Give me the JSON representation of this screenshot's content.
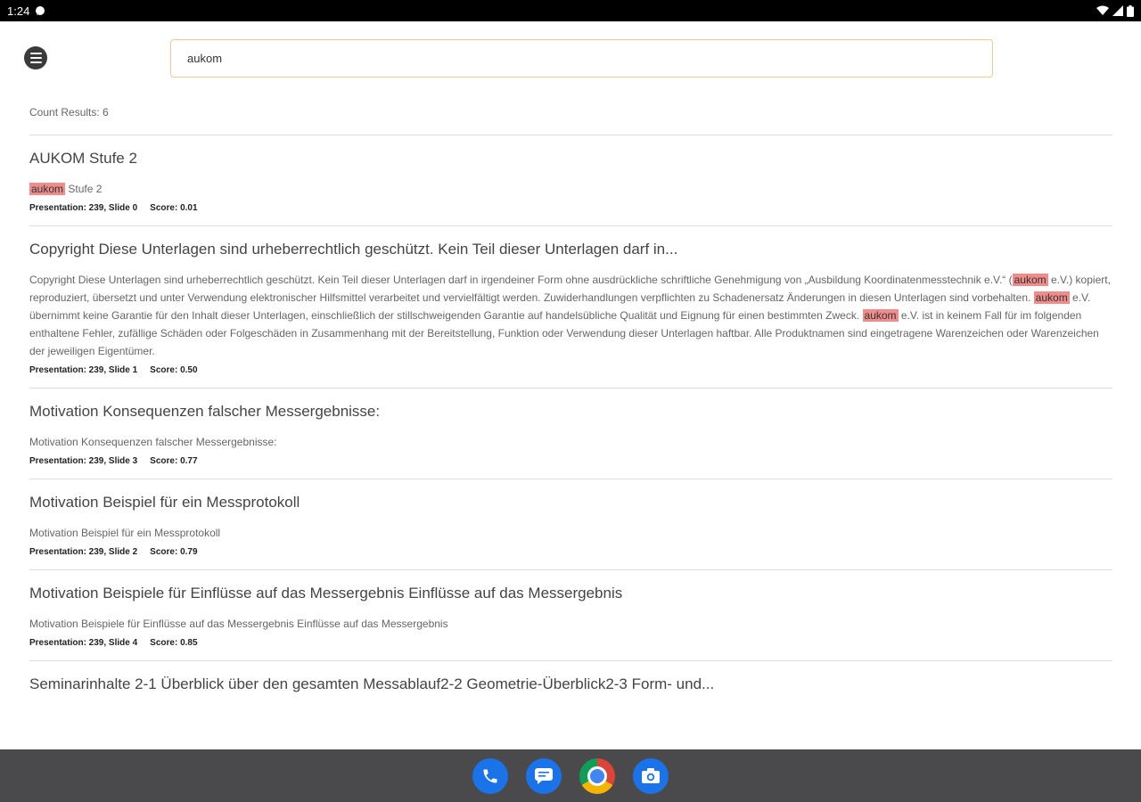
{
  "status_bar": {
    "time": "1:24"
  },
  "search": {
    "value": "aukom"
  },
  "count_label": "Count Results: 6",
  "highlight_term": "aukom",
  "results": [
    {
      "title": "AUKOM Stufe 2",
      "snippet_parts": [
        {
          "hl": true,
          "t": "aukom"
        },
        {
          "hl": false,
          "t": " Stufe 2"
        }
      ],
      "presentation": "Presentation: 239, Slide 0",
      "score": "Score: 0.01"
    },
    {
      "title": "Copyright Diese Unterlagen sind urheberrechtlich geschützt. Kein Teil dieser Unterlagen darf in...",
      "snippet_parts": [
        {
          "hl": false,
          "t": "Copyright Diese Unterlagen sind urheberrechtlich geschützt. Kein Teil dieser Unterlagen darf in irgendeiner Form ohne ausdrückliche schriftliche Genehmigung von „Ausbildung Koordinatenmesstechnik e.V.“ ("
        },
        {
          "hl": true,
          "t": "aukom"
        },
        {
          "hl": false,
          "t": " e.V.) kopiert, reproduziert, übersetzt und unter Verwendung elektronischer Hilfsmittel verarbeitet und vervielfältigt werden. Zuwiderhandlungen verpflichten zu Schadenersatz Änderungen in diesen Unterlagen sind vorbehalten. "
        },
        {
          "hl": true,
          "t": "aukom"
        },
        {
          "hl": false,
          "t": " e.V. übernimmt keine Garantie für den Inhalt dieser Unterlagen, einschließlich der stillschweigenden Garantie auf handelsübliche Qualität und Eignung für einen bestimmten Zweck. "
        },
        {
          "hl": true,
          "t": "aukom"
        },
        {
          "hl": false,
          "t": " e.V. ist in keinem Fall für im folgenden enthaltene Fehler, zufällige Schäden oder Folgeschäden in Zusammenhang mit der Bereitstellung, Funktion oder Verwendung dieser Unterlagen haftbar. Alle Produktnamen sind eingetragene Warenzeichen oder Warenzeichen der jeweiligen Eigentümer."
        }
      ],
      "presentation": "Presentation: 239, Slide 1",
      "score": "Score: 0.50"
    },
    {
      "title": "Motivation Konsequenzen falscher Messergebnisse:",
      "snippet_parts": [
        {
          "hl": false,
          "t": "Motivation Konsequenzen falscher Messergebnisse:"
        }
      ],
      "presentation": "Presentation: 239, Slide 3",
      "score": "Score: 0.77"
    },
    {
      "title": "Motivation Beispiel für ein Messprotokoll",
      "snippet_parts": [
        {
          "hl": false,
          "t": "Motivation Beispiel für ein Messprotokoll"
        }
      ],
      "presentation": "Presentation: 239, Slide 2",
      "score": "Score: 0.79"
    },
    {
      "title": "Motivation Beispiele für Einflüsse auf das Messergebnis Einflüsse auf das Messergebnis",
      "snippet_parts": [
        {
          "hl": false,
          "t": "Motivation Beispiele für Einflüsse auf das Messergebnis Einflüsse auf das Messergebnis"
        }
      ],
      "presentation": "Presentation: 239, Slide 4",
      "score": "Score: 0.85"
    },
    {
      "title": "Seminarinhalte 2-1 Überblick über den gesamten Messablauf2-2 Geometrie-Überblick2-3 Form- und...",
      "snippet_parts": [],
      "presentation": "",
      "score": ""
    }
  ],
  "dock": [
    {
      "name": "phone-app-icon"
    },
    {
      "name": "messages-app-icon"
    },
    {
      "name": "chrome-app-icon"
    },
    {
      "name": "camera-app-icon"
    }
  ]
}
